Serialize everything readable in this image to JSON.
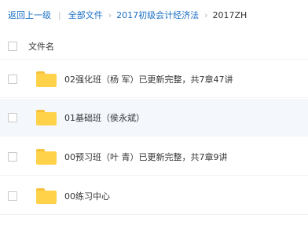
{
  "breadcrumb": {
    "back": "返回上一级",
    "separator": "|",
    "all_files": "全部文件",
    "chevron": "›",
    "level1": "2017初级会计经济法",
    "current": "2017ZH"
  },
  "list": {
    "header_label": "文件名",
    "items": [
      {
        "name": "02强化班（杨 军）已更新完整，共7章47讲",
        "icon": "folder-icon"
      },
      {
        "name": "01基础班（侯永斌）",
        "icon": "folder-icon"
      },
      {
        "name": "00预习班（叶 青）已更新完整，共7章9讲",
        "icon": "folder-icon"
      },
      {
        "name": "00练习中心",
        "icon": "folder-icon"
      }
    ]
  },
  "colors": {
    "link": "#1a6fc4",
    "folder": "#ffd24a",
    "hover_row": "#f4f7fc"
  }
}
